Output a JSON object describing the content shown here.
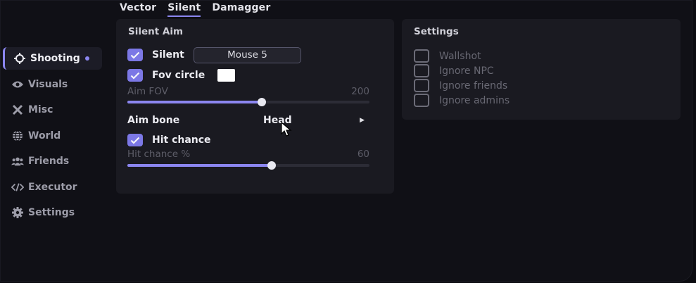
{
  "tabs": [
    {
      "label": "Vector",
      "active": false
    },
    {
      "label": "Silent",
      "active": true
    },
    {
      "label": "Damagger",
      "active": false
    }
  ],
  "sidebar": {
    "items": [
      {
        "label": "Shooting",
        "icon": "crosshair-icon",
        "active": true
      },
      {
        "label": "Visuals",
        "icon": "eye-icon",
        "active": false
      },
      {
        "label": "Misc",
        "icon": "tools-icon",
        "active": false
      },
      {
        "label": "World",
        "icon": "globe-icon",
        "active": false
      },
      {
        "label": "Friends",
        "icon": "users-icon",
        "active": false
      },
      {
        "label": "Executor",
        "icon": "code-icon",
        "active": false
      },
      {
        "label": "Settings",
        "icon": "gear-icon",
        "active": false
      }
    ]
  },
  "silent_aim": {
    "title": "Silent Aim",
    "silent": {
      "label": "Silent",
      "checked": true,
      "keybind": "Mouse 5"
    },
    "fov_circle": {
      "label": "Fov circle",
      "checked": true,
      "color": "#ffffff"
    },
    "aim_fov": {
      "label": "Aim FOV",
      "value": "200",
      "fraction": 0.555
    },
    "aim_bone": {
      "label": "Aim bone",
      "value": "Head"
    },
    "hit_chance": {
      "label": "Hit chance",
      "checked": true
    },
    "hit_chance_pct": {
      "label": "Hit chance %",
      "value": "60",
      "fraction": 0.597
    }
  },
  "settings": {
    "title": "Settings",
    "options": [
      {
        "label": "Wallshot",
        "checked": false
      },
      {
        "label": "Ignore NPC",
        "checked": false
      },
      {
        "label": "Ignore friends",
        "checked": false
      },
      {
        "label": "Ignore admins",
        "checked": false
      }
    ]
  },
  "colors": {
    "accent": "#8b86f0",
    "panel": "#1a1a21",
    "background": "#101016"
  }
}
